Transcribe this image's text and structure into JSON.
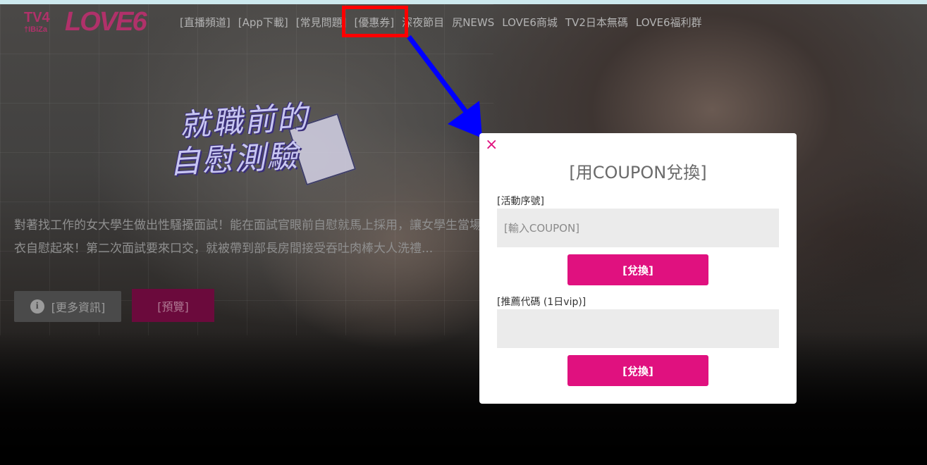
{
  "logo": {
    "tv4": "TV4",
    "ibiza": "†IBiZa",
    "love6": "LOVE6"
  },
  "nav": {
    "items": [
      "[直播頻道]",
      "[App下載]",
      "[常見問題]",
      "[優惠券]",
      "深夜節目",
      "尻NEWS",
      "LOVE6商城",
      "TV2日本無碼",
      "LOVE6福利群"
    ]
  },
  "hero": {
    "title_line1": "就職前的",
    "title_line2": "自慰測驗",
    "description": "對著找工作的女大學生做出性騷擾面試！能在面試官眼前自慰就馬上採用，讓女學生當場脫衣自慰起來！第二次面試要來口交，就被帶到部長房間接受吞吐肉棒大人洗禮...",
    "more_info_label": "[更多資訊]",
    "preview_label": "[預覽]"
  },
  "modal": {
    "close_symbol": "×",
    "title": "[用COUPON兌換]",
    "event_code_label": "[活動序號]",
    "event_code_placeholder": "[輸入COUPON]",
    "event_code_value": "",
    "redeem_label_1": "[兌換]",
    "referral_label": "[推薦代碼 (1日vip)]",
    "referral_placeholder": "",
    "referral_value": "",
    "redeem_label_2": "[兌換]"
  },
  "colors": {
    "accent": "#e0117f",
    "logo": "#b0316a",
    "highlight": "#ff0000",
    "arrow": "#0000ff"
  }
}
